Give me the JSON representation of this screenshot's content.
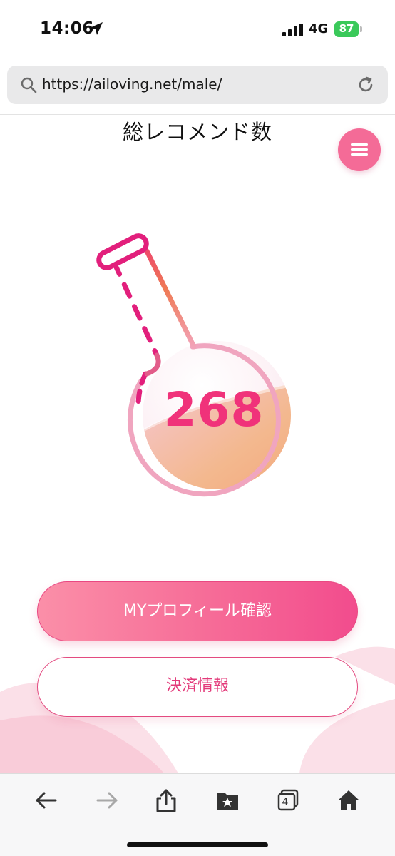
{
  "status_bar": {
    "time": "14:06",
    "network": "4G",
    "battery_level": "87",
    "battery_color": "#3ac95a",
    "icons": [
      "location-arrow-icon",
      "signal-bars-icon",
      "battery-charging-icon"
    ]
  },
  "browser": {
    "url": "https://ailoving.net/male/",
    "tab_count": "4"
  },
  "page": {
    "title": "総レコメンド数",
    "recommend_count": "268",
    "buttons": {
      "profile": "MYプロフィール確認",
      "payment": "決済情報"
    }
  },
  "toolbar": {
    "icons": [
      "back-arrow-icon",
      "forward-arrow-icon",
      "share-icon",
      "bookmarks-icon",
      "tabs-icon",
      "home-icon"
    ]
  },
  "colors": {
    "accent_pink": "#f46b97",
    "count_pink": "#f0327a",
    "flask_liquid": "#f3ae7e"
  }
}
